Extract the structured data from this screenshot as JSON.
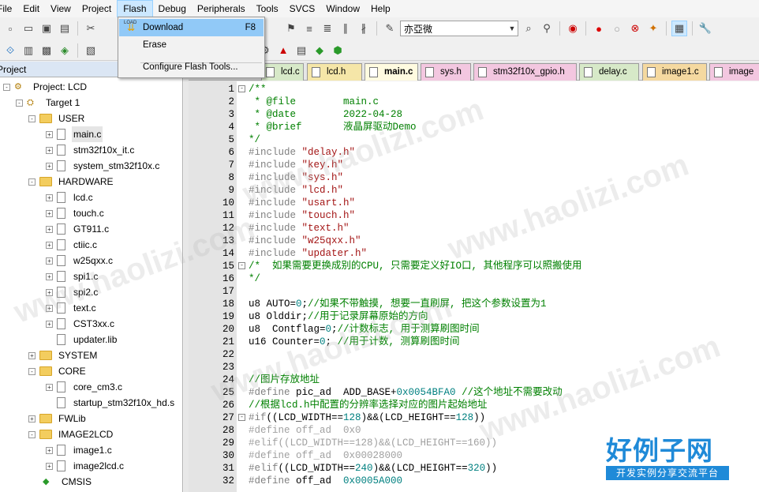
{
  "menubar": {
    "items": [
      "File",
      "Edit",
      "View",
      "Project",
      "Flash",
      "Debug",
      "Peripherals",
      "Tools",
      "SVCS",
      "Window",
      "Help"
    ],
    "active": "Flash"
  },
  "toolbar": {
    "target_dropdown": "亦亞微"
  },
  "flash_menu": {
    "items": [
      {
        "label": "Download",
        "shortcut": "F8"
      },
      {
        "label": "Erase",
        "shortcut": ""
      },
      {
        "label": "Configure Flash Tools...",
        "shortcut": ""
      }
    ],
    "download_icon_text": "LOAD"
  },
  "project": {
    "header": "Project",
    "root": "Project: LCD",
    "target": "Target 1",
    "groups": [
      {
        "name": "USER",
        "files": [
          "main.c",
          "stm32f10x_it.c",
          "system_stm32f10x.c"
        ]
      },
      {
        "name": "HARDWARE",
        "files": [
          "lcd.c",
          "touch.c",
          "GT911.c",
          "ctiic.c",
          "w25qxx.c",
          "spi1.c",
          "spi2.c",
          "text.c",
          "CST3xx.c",
          "updater.lib"
        ]
      },
      {
        "name": "SYSTEM",
        "files": []
      },
      {
        "name": "CORE",
        "files": [
          "core_cm3.c",
          "startup_stm32f10x_hd.s"
        ]
      },
      {
        "name": "FWLib",
        "files": []
      },
      {
        "name": "IMAGE2LCD",
        "files": [
          "image1.c",
          "image2lcd.c"
        ]
      },
      {
        "name": "CMSIS",
        "files": []
      }
    ]
  },
  "tabs": [
    "lcd.c",
    "lcd.h",
    "main.c",
    "sys.h",
    "stm32f10x_gpio.h",
    "delay.c",
    "image1.c",
    "image"
  ],
  "active_tab": "main.c",
  "code": [
    {
      "n": "1",
      "fold": "-",
      "parts": [
        [
          "c-com",
          "/**"
        ]
      ]
    },
    {
      "n": "2",
      "parts": [
        [
          "c-com",
          " * @file        main.c"
        ]
      ]
    },
    {
      "n": "3",
      "parts": [
        [
          "c-com",
          " * @date        2022-04-28"
        ]
      ]
    },
    {
      "n": "4",
      "parts": [
        [
          "c-com",
          " * @brief       液晶屏驱动Demo"
        ]
      ]
    },
    {
      "n": "5",
      "parts": [
        [
          "c-com",
          "*/"
        ]
      ]
    },
    {
      "n": "6",
      "parts": [
        [
          "c-pp",
          "#include "
        ],
        [
          "c-str",
          "\"delay.h\""
        ]
      ]
    },
    {
      "n": "7",
      "parts": [
        [
          "c-pp",
          "#include "
        ],
        [
          "c-str",
          "\"key.h\""
        ]
      ]
    },
    {
      "n": "8",
      "parts": [
        [
          "c-pp",
          "#include "
        ],
        [
          "c-str",
          "\"sys.h\""
        ]
      ]
    },
    {
      "n": "9",
      "parts": [
        [
          "c-pp",
          "#include "
        ],
        [
          "c-str",
          "\"lcd.h\""
        ]
      ]
    },
    {
      "n": "10",
      "parts": [
        [
          "c-pp",
          "#include "
        ],
        [
          "c-str",
          "\"usart.h\""
        ]
      ]
    },
    {
      "n": "11",
      "parts": [
        [
          "c-pp",
          "#include "
        ],
        [
          "c-str",
          "\"touch.h\""
        ]
      ]
    },
    {
      "n": "12",
      "parts": [
        [
          "c-pp",
          "#include "
        ],
        [
          "c-str",
          "\"text.h\""
        ]
      ]
    },
    {
      "n": "13",
      "parts": [
        [
          "c-pp",
          "#include "
        ],
        [
          "c-str",
          "\"w25qxx.h\""
        ]
      ]
    },
    {
      "n": "14",
      "parts": [
        [
          "c-pp",
          "#include "
        ],
        [
          "c-str",
          "\"updater.h\""
        ]
      ]
    },
    {
      "n": "15",
      "fold": "-",
      "parts": [
        [
          "c-com",
          "/*  如果需要更换成别的CPU, 只需要定义好IO口, 其他程序可以照搬使用"
        ]
      ]
    },
    {
      "n": "16",
      "parts": [
        [
          "c-com",
          "*/"
        ]
      ]
    },
    {
      "n": "17",
      "parts": []
    },
    {
      "n": "18",
      "parts": [
        [
          "c-pl",
          "u8 AUTO="
        ],
        [
          "c-num",
          "0"
        ],
        [
          "c-pl",
          ";"
        ],
        [
          "c-com",
          "//如果不带触摸, 想要一直刷屏, 把这个参数设置为1"
        ]
      ]
    },
    {
      "n": "19",
      "parts": [
        [
          "c-pl",
          "u8 Olddir;"
        ],
        [
          "c-com",
          "//用于记录屏幕原始的方向"
        ]
      ]
    },
    {
      "n": "20",
      "parts": [
        [
          "c-pl",
          "u8  Contflag="
        ],
        [
          "c-num",
          "0"
        ],
        [
          "c-pl",
          ";"
        ],
        [
          "c-com",
          "//计数标志, 用于测算刷图时间"
        ]
      ]
    },
    {
      "n": "21",
      "parts": [
        [
          "c-pl",
          "u16 Counter="
        ],
        [
          "c-num",
          "0"
        ],
        [
          "c-pl",
          "; "
        ],
        [
          "c-com",
          "//用于计数, 测算刷图时间"
        ]
      ]
    },
    {
      "n": "22",
      "parts": []
    },
    {
      "n": "23",
      "parts": []
    },
    {
      "n": "24",
      "parts": [
        [
          "c-com",
          "//图片存放地址"
        ]
      ]
    },
    {
      "n": "25",
      "parts": [
        [
          "c-pp",
          "#define "
        ],
        [
          "c-pl",
          "pic_ad  ADD_BASE+"
        ],
        [
          "c-num",
          "0x0054BFA0"
        ],
        [
          "c-pl",
          " "
        ],
        [
          "c-com",
          "//这个地址不需要改动"
        ]
      ]
    },
    {
      "n": "26",
      "parts": [
        [
          "c-com",
          "//根据lcd.h中配置的分辨率选择对应的图片起始地址"
        ]
      ]
    },
    {
      "n": "27",
      "fold": "-",
      "parts": [
        [
          "c-pp",
          "#if"
        ],
        [
          "c-pl",
          "((LCD_WIDTH=="
        ],
        [
          "c-num",
          "128"
        ],
        [
          "c-pl",
          ")&&(LCD_HEIGHT=="
        ],
        [
          "c-num",
          "128"
        ],
        [
          "c-pl",
          "))"
        ]
      ]
    },
    {
      "n": "28",
      "parts": [
        [
          "c-grey",
          "#define off_ad  0x0"
        ]
      ]
    },
    {
      "n": "29",
      "parts": [
        [
          "c-grey",
          "#elif((LCD_WIDTH==128)&&(LCD_HEIGHT==160))"
        ]
      ]
    },
    {
      "n": "30",
      "parts": [
        [
          "c-grey",
          "#define off_ad  0x00028000"
        ]
      ]
    },
    {
      "n": "31",
      "parts": [
        [
          "c-pp",
          "#elif"
        ],
        [
          "c-pl",
          "((LCD_WIDTH=="
        ],
        [
          "c-num",
          "240"
        ],
        [
          "c-pl",
          ")&&(LCD_HEIGHT=="
        ],
        [
          "c-num",
          "320"
        ],
        [
          "c-pl",
          "))"
        ]
      ]
    },
    {
      "n": "32",
      "parts": [
        [
          "c-pp",
          "#define "
        ],
        [
          "c-pl",
          "off_ad  "
        ],
        [
          "c-num",
          "0x0005A000"
        ]
      ]
    }
  ],
  "watermark": {
    "logo_big": "好例子网",
    "logo_small": "开发实例分享交流平台",
    "diag_text": "www.haolizi.com"
  },
  "colors": {
    "comment": "#008000",
    "string": "#a31515",
    "number": "#008080",
    "preprocessor": "#808080",
    "menu_highlight": "#91c9f7",
    "watermark_blue": "#1f8ad8"
  }
}
